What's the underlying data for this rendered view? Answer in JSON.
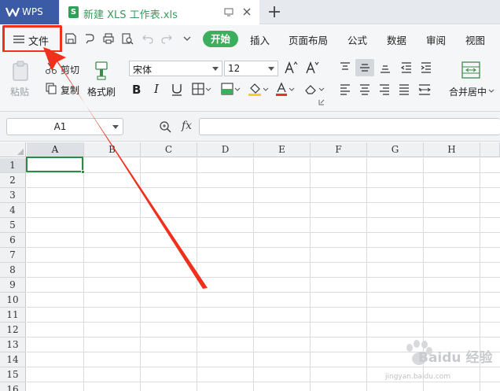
{
  "titlebar": {
    "app_name": "WPS",
    "document_tab": "新建 XLS 工作表.xls",
    "xls_badge": "S"
  },
  "menu": {
    "file_label": "文件",
    "tabs": [
      "开始",
      "插入",
      "页面布局",
      "公式",
      "数据",
      "审阅",
      "视图"
    ]
  },
  "ribbon": {
    "paste_label": "粘贴",
    "cut_label": "剪切",
    "copy_label": "复制",
    "format_painter_label": "格式刷",
    "font_name": "宋体",
    "font_size": "12",
    "merge_center_label": "合并居中"
  },
  "formula_bar": {
    "cell_reference": "A1",
    "fx_label": "fx",
    "formula_value": ""
  },
  "grid": {
    "columns": [
      "A",
      "B",
      "C",
      "D",
      "E",
      "F",
      "G",
      "H"
    ],
    "rows": [
      "1",
      "2",
      "3",
      "4",
      "5",
      "6",
      "7",
      "8",
      "9",
      "10",
      "11",
      "12",
      "13",
      "14",
      "15",
      "16"
    ],
    "selected_cell": "A1"
  },
  "watermark": {
    "brand": "Baidu 经验",
    "url": "jingyan.baidu.com"
  },
  "colors": {
    "accent_green": "#3dae5d",
    "title_blue": "#3b5ba7",
    "annotation_red": "#f0301c"
  }
}
